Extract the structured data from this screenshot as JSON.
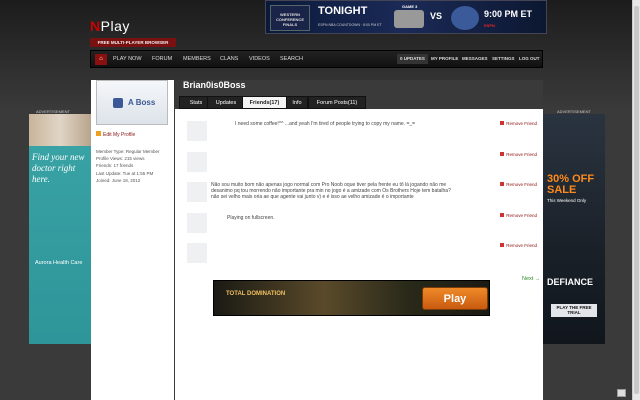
{
  "header": {
    "logo_prefix": "N",
    "logo_rest": "Play",
    "tagline": "FREE MULTI-PLAYER BROWSER GAMES"
  },
  "banner": {
    "left_text": "WESTERN CONFERENCE FINALS",
    "tonight": "TONIGHT",
    "countdown": "ESPN NBA COUNTDOWN · 8:00 PM ET",
    "game": "GAME 3",
    "vs": "VS",
    "time": "9:00 PM ET",
    "network": "ESPN"
  },
  "nav": {
    "items": [
      "PLAY NOW",
      "FORUM",
      "MEMBERS",
      "CLANS",
      "VIDEOS",
      "SEARCH"
    ],
    "updates": "0 UPDATES",
    "right_items": [
      "MY PROFILE",
      "MESSAGES",
      "SETTINGS",
      "LOG OUT"
    ]
  },
  "ads": {
    "left_label": "ADVERTISEMENT",
    "right_label": "ADVERTISEMENT",
    "left_headline": "Find your new doctor right here.",
    "left_brand": "Aurora Health Care",
    "right_sale": "30% OFF SALE",
    "right_sub": "This Weekend Only",
    "right_title": "DEFIANCE",
    "right_cta": "PLAY THE FREE TRIAL"
  },
  "profile": {
    "avatar_label": "A Boss",
    "edit_link": "Edit My Profile",
    "stats": [
      "Member Type: Regular Member",
      "Profile Views: 215 views",
      "Friends: 17 friends",
      "Last Update: Tue at 1:55 PM",
      "Joined: June 18, 2012"
    ],
    "username": "Brian0is0Boss"
  },
  "tabs": [
    "Stats",
    "Updates",
    "Friends(17)",
    "Info",
    "Forum Posts(11)"
  ],
  "friends": [
    {
      "message": "I need some coffee!^^ ...and yeah I'm tired of people trying to copy my name. =_=",
      "remove": "Remove Friend"
    },
    {
      "message": "",
      "remove": "Remove Friend"
    },
    {
      "message": "Não sou muito bom não apenas jogo normal com Pro Noob oque tiver pela frente eu tô lá jogando não me desanimo pq tou morrendo não importante pra min no jogo é a amizade com Os Brothers Hoje tem batalha?não sei velho mais oria ae que agente vai junto v) e é isso ae velho amizade é o importante",
      "remove": "Remove Friend"
    },
    {
      "message": "Playing on fullscreen.",
      "remove": "Remove Friend"
    },
    {
      "message": "",
      "remove": "Remove Friend"
    }
  ],
  "pagination": {
    "next": "Next →"
  },
  "game_ad": {
    "title": "TOTAL DOMINATION",
    "button": "Play"
  }
}
